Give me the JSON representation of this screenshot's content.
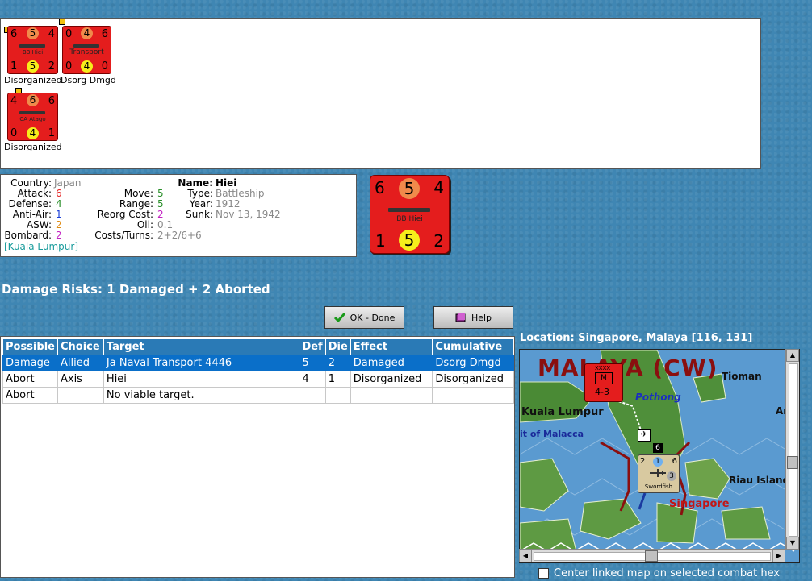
{
  "units": [
    {
      "name": "BB Hiei",
      "tl": "6",
      "tc": "5",
      "tr": "4",
      "bl": "1",
      "bc": "5",
      "br": "2",
      "status": "Disorganized"
    },
    {
      "name": "Transport",
      "tl": "0",
      "tc": "4",
      "tr": "6",
      "bl": "0",
      "bc": "4",
      "br": "0",
      "status": "Dsorg Dmgd"
    },
    {
      "name": "CA Atago",
      "tl": "4",
      "tc": "6",
      "tr": "6",
      "bl": "0",
      "bc": "4",
      "br": "1",
      "status": "Disorganized"
    }
  ],
  "info": {
    "country_label": "Country:",
    "country": "Japan",
    "attack_label": "Attack:",
    "attack": "6",
    "defense_label": "Defense:",
    "defense": "4",
    "antiair_label": "Anti-Air:",
    "antiair": "1",
    "asw_label": "ASW:",
    "asw": "2",
    "bombard_label": "Bombard:",
    "bombard": "2",
    "location": "[Kuala Lumpur]",
    "move_label": "Move:",
    "move": "5",
    "range_label": "Range:",
    "range": "5",
    "reorg_label": "Reorg Cost:",
    "reorg": "2",
    "oil_label": "Oil:",
    "oil": "0.1",
    "costs_label": "Costs/Turns:",
    "costs": "2+2/6+6",
    "name_label": "Name:",
    "name": "Hiei",
    "type_label": "Type:",
    "type": "Battleship",
    "year_label": "Year:",
    "year": "1912",
    "sunk_label": "Sunk:",
    "sunk": "Nov 13, 1942"
  },
  "big_counter": {
    "name": "BB Hiei",
    "tl": "6",
    "tc": "5",
    "tr": "4",
    "bl": "1",
    "bc": "5",
    "br": "2"
  },
  "damage_risks": "Damage Risks:  1 Damaged + 2 Aborted",
  "buttons": {
    "ok": "OK - Done",
    "help": "Help"
  },
  "table": {
    "headers": [
      "Possible",
      "Choice",
      "Target",
      "Def",
      "Die",
      "Effect",
      "Cumulative"
    ],
    "rows": [
      [
        "Damage",
        "Allied",
        "Ja Naval Transport 4446",
        "5",
        "2",
        "Damaged",
        "Dsorg Dmgd"
      ],
      [
        "Abort",
        "Axis",
        "Hiei",
        "4",
        "1",
        "Disorganized",
        "Disorganized"
      ],
      [
        "Abort",
        "",
        "No viable target.",
        "",
        "",
        "",
        ""
      ]
    ]
  },
  "location": "Location:  Singapore, Malaya [116, 131]",
  "map": {
    "region": "MALAYA (CW)",
    "labels": {
      "tioman": "Tioman",
      "pothong": "Pothong",
      "kl": "Kuala Lumpur",
      "strait": "it of Malacca",
      "riau": "Riau Island",
      "singapore": "Singapore",
      "an": "An"
    },
    "unit1": {
      "top": "XXXX",
      "center": "M",
      "bottom": "4-3"
    },
    "unit2": {
      "tl": "2",
      "tr": "6",
      "c": "1",
      "r": "3",
      "name": "Swordfish"
    },
    "hexnum": "6"
  },
  "center_check": "Center linked map on selected combat hex",
  "colors": {
    "counter": "#e41d1d",
    "header": "#2a7ab6",
    "selected": "#0a6fc9"
  }
}
